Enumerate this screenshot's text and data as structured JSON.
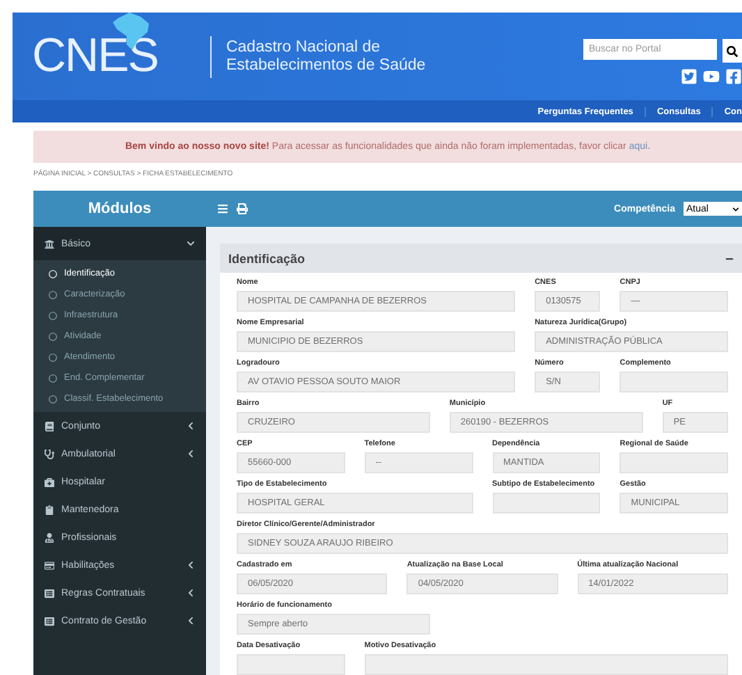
{
  "header": {
    "logo": "CNES",
    "subtitle": [
      "Cadastro Nacional de",
      "Estabelecimentos de Saúde"
    ],
    "search": {
      "placeholder": "Buscar no Portal"
    }
  },
  "nav": [
    "Perguntas Frequentes",
    "Consultas",
    "Con"
  ],
  "alert": {
    "text": "**Bem vindo ao nosso novo site!** Para acessar as funcionalidades que ainda não foram implementadas, favor clicar ",
    "link": "aqui",
    "after": "."
  },
  "breadcrumb": "PÁGINA INICIAL > CONSULTAS > FICHA ESTABELECIMENTO",
  "sidebar": {
    "title": "Módulos",
    "items": [
      {
        "label": "Básico",
        "expanded": true,
        "children": [
          {
            "label": "Identificação",
            "selected": true
          },
          {
            "label": "Caracterização",
            "selected": false
          },
          {
            "label": "Infraestrutura",
            "selected": false
          },
          {
            "label": "Atividade",
            "selected": false
          },
          {
            "label": "Atendimento",
            "selected": false
          },
          {
            "label": "End. Complementar",
            "selected": false
          },
          {
            "label": "Classif. Estabelecimento",
            "selected": false
          }
        ]
      },
      {
        "label": "Conjunto",
        "expanded": false
      },
      {
        "label": "Ambulatorial",
        "expanded": false
      },
      {
        "label": "Hospitalar"
      },
      {
        "label": "Mantenedora"
      },
      {
        "label": "Profissionais"
      },
      {
        "label": "Habilitações",
        "expanded": false
      },
      {
        "label": "Regras Contratuais",
        "expanded": false
      },
      {
        "label": "Contrato de Gestão",
        "expanded": false
      }
    ]
  },
  "toolbar": {
    "competencia": {
      "label": "Competência",
      "value": "Atual"
    }
  },
  "panel": {
    "title": "Identificação",
    "rows": [
      [
        {
          "label": "Nome",
          "value": "HOSPITAL DE CAMPANHA DE BEZERROS"
        },
        {
          "label": "CNES",
          "value": "0130575"
        },
        {
          "label": "CNPJ",
          "value": "—"
        }
      ],
      [
        {
          "label": "Nome Empresarial",
          "value": "MUNICIPIO DE BEZERROS"
        },
        {
          "label": "Natureza Jurídica(Grupo)",
          "value": "ADMINISTRAÇÃO PÚBLICA"
        }
      ],
      [
        {
          "label": "Logradouro",
          "value": "AV OTAVIO PESSOA SOUTO MAIOR"
        },
        {
          "label": "Número",
          "value": "S/N"
        },
        {
          "label": "Complemento"
        }
      ],
      [
        {
          "label": "Bairro",
          "value": "CRUZEIRO"
        },
        {
          "label": "Município",
          "value": "260190 - BEZERROS"
        },
        {
          "label": "UF",
          "value": "PE"
        }
      ],
      [
        {
          "label": "CEP",
          "value": "55660-000"
        },
        {
          "label": "Telefone",
          "value": "--"
        },
        {
          "label": "Dependência",
          "value": "MANTIDA"
        },
        {
          "label": "Regional de Saúde"
        }
      ],
      [
        {
          "label": "Tipo de Estabelecimento",
          "value": "HOSPITAL GERAL"
        },
        {
          "label": "Subtipo de Estabelecimento"
        },
        {
          "label": "Gestão",
          "value": "MUNICIPAL"
        }
      ],
      [
        {
          "label": "Diretor Clínico/Gerente/Administrador",
          "value": "SIDNEY SOUZA ARAUJO RIBEIRO"
        }
      ],
      [
        {
          "label": "Cadastrado em",
          "value": "06/05/2020"
        },
        {
          "label": "Atualização na Base Local",
          "value": "04/05/2020"
        },
        {
          "label": "Última atualização Nacional",
          "value": "14/01/2022"
        }
      ],
      [
        {
          "label": "Horário de funcionamento",
          "value": "Sempre aberto"
        }
      ],
      [
        {
          "label": "Data Desativação"
        },
        {
          "label": "Motivo Desativação"
        }
      ]
    ]
  }
}
